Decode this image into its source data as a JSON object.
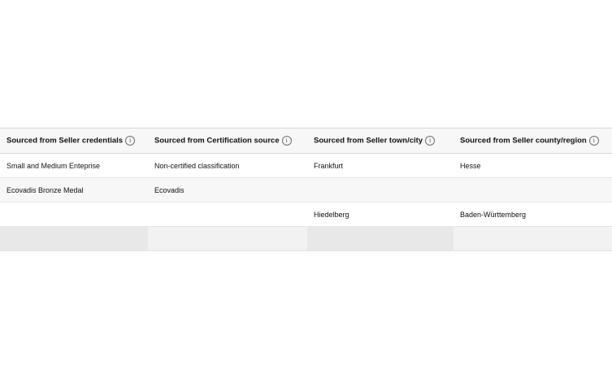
{
  "table": {
    "columns": [
      {
        "label": "Sourced from Seller credentials"
      },
      {
        "label": "Sourced from Certification source"
      },
      {
        "label": "Sourced from Seller town/city"
      },
      {
        "label": "Sourced from Seller county/region"
      }
    ],
    "info_icon": {
      "glyph": "i",
      "name": "info-icon"
    },
    "rows": [
      [
        "Small and Medium Enteprise",
        "Non-certified classification",
        "Frankfurt",
        "Hesse"
      ],
      [
        "Ecovadis Bronze Medal",
        "Ecovadis",
        "",
        ""
      ],
      [
        "",
        "",
        "Hiedelberg",
        "Baden-Württemberg"
      ],
      [
        "",
        "",
        "",
        ""
      ]
    ]
  }
}
